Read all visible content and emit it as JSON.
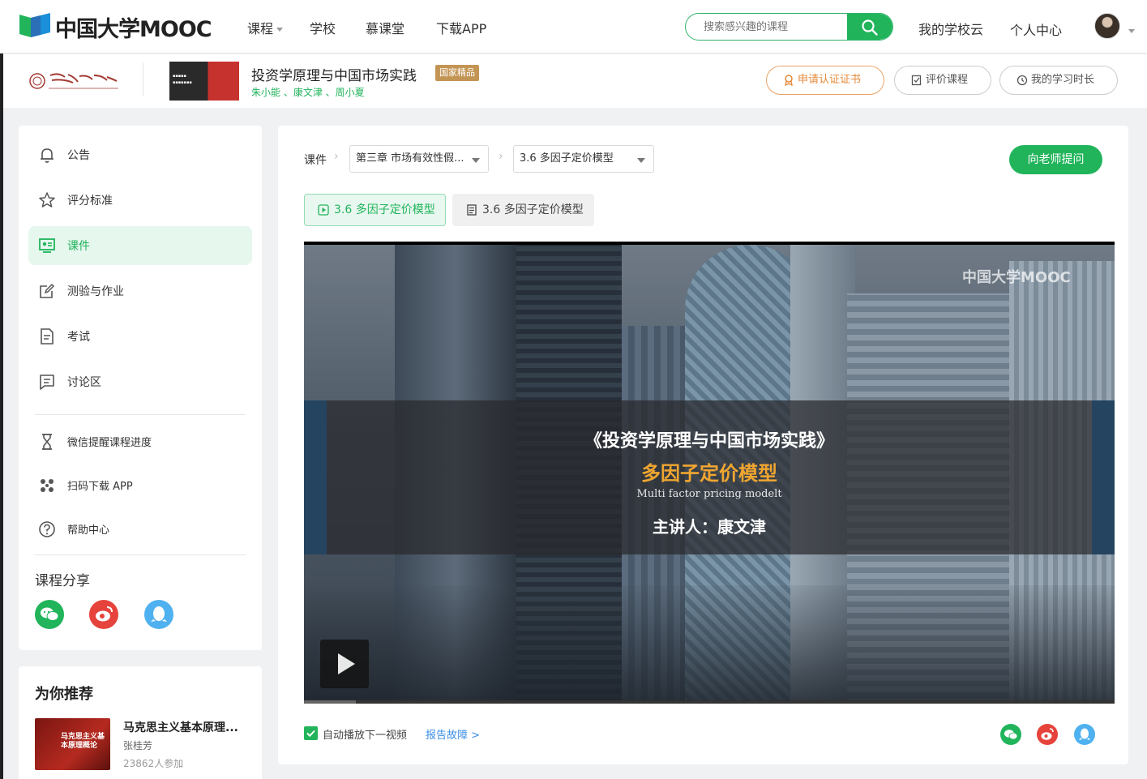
{
  "topnav": {
    "logo": "中国大学MOOC",
    "items": [
      {
        "label": "课程",
        "dropdown": true
      },
      {
        "label": "学校"
      },
      {
        "label": "慕课堂"
      },
      {
        "label": "下载APP"
      }
    ],
    "search_placeholder": "搜索感兴趣的课程",
    "school_cloud": "我的学校云",
    "personal_center": "个人中心"
  },
  "course": {
    "title": "投资学原理与中国市场实践",
    "badge": "国家精品",
    "teachers": "朱小能 、康文津 、周小夏",
    "buttons": {
      "certificate": "申请认证证书",
      "review": "评价课程",
      "study_time": "我的学习时长"
    }
  },
  "sidebar": {
    "items": [
      {
        "label": "公告",
        "icon": "bell-icon"
      },
      {
        "label": "评分标准",
        "icon": "star-icon"
      },
      {
        "label": "课件",
        "icon": "courseware-icon",
        "active": true
      },
      {
        "label": "测验与作业",
        "icon": "edit-icon"
      },
      {
        "label": "考试",
        "icon": "exam-icon"
      },
      {
        "label": "讨论区",
        "icon": "discussion-icon"
      }
    ],
    "tools": [
      {
        "label": "微信提醒课程进度",
        "icon": "hourglass-icon"
      },
      {
        "label": "扫码下载 APP",
        "icon": "qr-icon"
      },
      {
        "label": "帮助中心",
        "icon": "help-icon"
      }
    ],
    "share_title": "课程分享"
  },
  "recommend": {
    "title": "为你推荐",
    "item": {
      "thumb_text": "马克思主义基本原理概论",
      "name": "马克思主义基本原理...",
      "teacher": "张桂芳",
      "count": "23862人参加"
    }
  },
  "main": {
    "crumb_label": "课件",
    "chapter_select": "第三章 市场有效性假...",
    "lesson_select": "3.6 多因子定价模型",
    "ask_button": "向老师提问",
    "tabs": [
      {
        "label": "3.6 多因子定价模型",
        "type": "video",
        "active": true
      },
      {
        "label": "3.6 多因子定价模型",
        "type": "document",
        "active": false
      }
    ],
    "video": {
      "watermark": "中国大学MOOC",
      "title": "《投资学原理与中国市场实践》",
      "subtitle": "多因子定价模型",
      "english": "Multi factor pricing modelt",
      "lecturer": "主讲人：康文津",
      "progress": 0.064
    },
    "autoplay_label": "自动播放下一视频",
    "autoplay_checked": true,
    "report_link": "报告故障 >"
  },
  "colors": {
    "brand_green": "#21b45b",
    "badge_gold": "#c39554",
    "link_blue": "#3a8ee6"
  }
}
